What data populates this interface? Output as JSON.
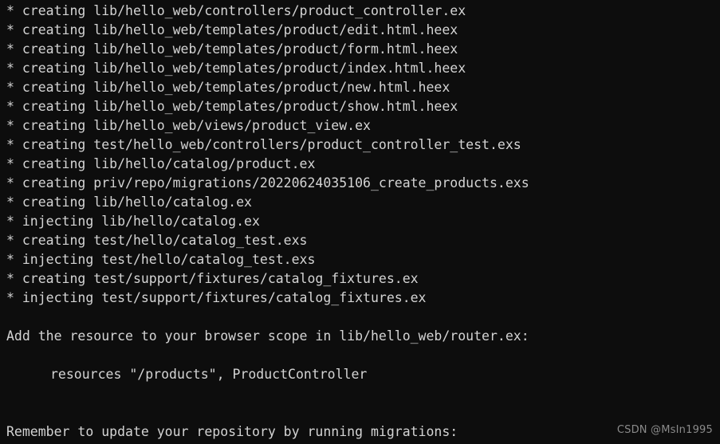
{
  "terminal": {
    "background_color": "#0d0d0d",
    "text_color": "#d4d4d4",
    "lines": [
      {
        "id": "line-1",
        "text": "* creating lib/hello_web/controllers/product_controller.ex",
        "indent": false,
        "blank": false
      },
      {
        "id": "line-2",
        "text": "* creating lib/hello_web/templates/product/edit.html.heex",
        "indent": false,
        "blank": false
      },
      {
        "id": "line-3",
        "text": "* creating lib/hello_web/templates/product/form.html.heex",
        "indent": false,
        "blank": false
      },
      {
        "id": "line-4",
        "text": "* creating lib/hello_web/templates/product/index.html.heex",
        "indent": false,
        "blank": false
      },
      {
        "id": "line-5",
        "text": "* creating lib/hello_web/templates/product/new.html.heex",
        "indent": false,
        "blank": false
      },
      {
        "id": "line-6",
        "text": "* creating lib/hello_web/templates/product/show.html.heex",
        "indent": false,
        "blank": false
      },
      {
        "id": "line-7",
        "text": "* creating lib/hello_web/views/product_view.ex",
        "indent": false,
        "blank": false
      },
      {
        "id": "line-8",
        "text": "* creating test/hello_web/controllers/product_controller_test.exs",
        "indent": false,
        "blank": false
      },
      {
        "id": "line-9",
        "text": "* creating lib/hello/catalog/product.ex",
        "indent": false,
        "blank": false
      },
      {
        "id": "line-10",
        "text": "* creating priv/repo/migrations/20220624035106_create_products.exs",
        "indent": false,
        "blank": false
      },
      {
        "id": "line-11",
        "text": "* creating lib/hello/catalog.ex",
        "indent": false,
        "blank": false
      },
      {
        "id": "line-12",
        "text": "* injecting lib/hello/catalog.ex",
        "indent": false,
        "blank": false
      },
      {
        "id": "line-13",
        "text": "* creating test/hello/catalog_test.exs",
        "indent": false,
        "blank": false
      },
      {
        "id": "line-14",
        "text": "* injecting test/hello/catalog_test.exs",
        "indent": false,
        "blank": false
      },
      {
        "id": "line-15",
        "text": "* creating test/support/fixtures/catalog_fixtures.ex",
        "indent": false,
        "blank": false
      },
      {
        "id": "line-16",
        "text": "* injecting test/support/fixtures/catalog_fixtures.ex",
        "indent": false,
        "blank": false
      },
      {
        "id": "line-17",
        "text": " ",
        "indent": false,
        "blank": true
      },
      {
        "id": "line-18",
        "text": "Add the resource to your browser scope in lib/hello_web/router.ex:",
        "indent": false,
        "blank": false
      },
      {
        "id": "line-19",
        "text": " ",
        "indent": false,
        "blank": true
      },
      {
        "id": "line-20",
        "text": "resources \"/products\", ProductController",
        "indent": true,
        "blank": false
      },
      {
        "id": "line-21",
        "text": " ",
        "indent": false,
        "blank": true
      },
      {
        "id": "line-22",
        "text": " ",
        "indent": false,
        "blank": true
      },
      {
        "id": "line-23",
        "text": "Remember to update your repository by running migrations:",
        "indent": false,
        "blank": false
      }
    ]
  },
  "watermark": {
    "text": "CSDN @MsIn1995",
    "color": "#8a8a8a"
  }
}
